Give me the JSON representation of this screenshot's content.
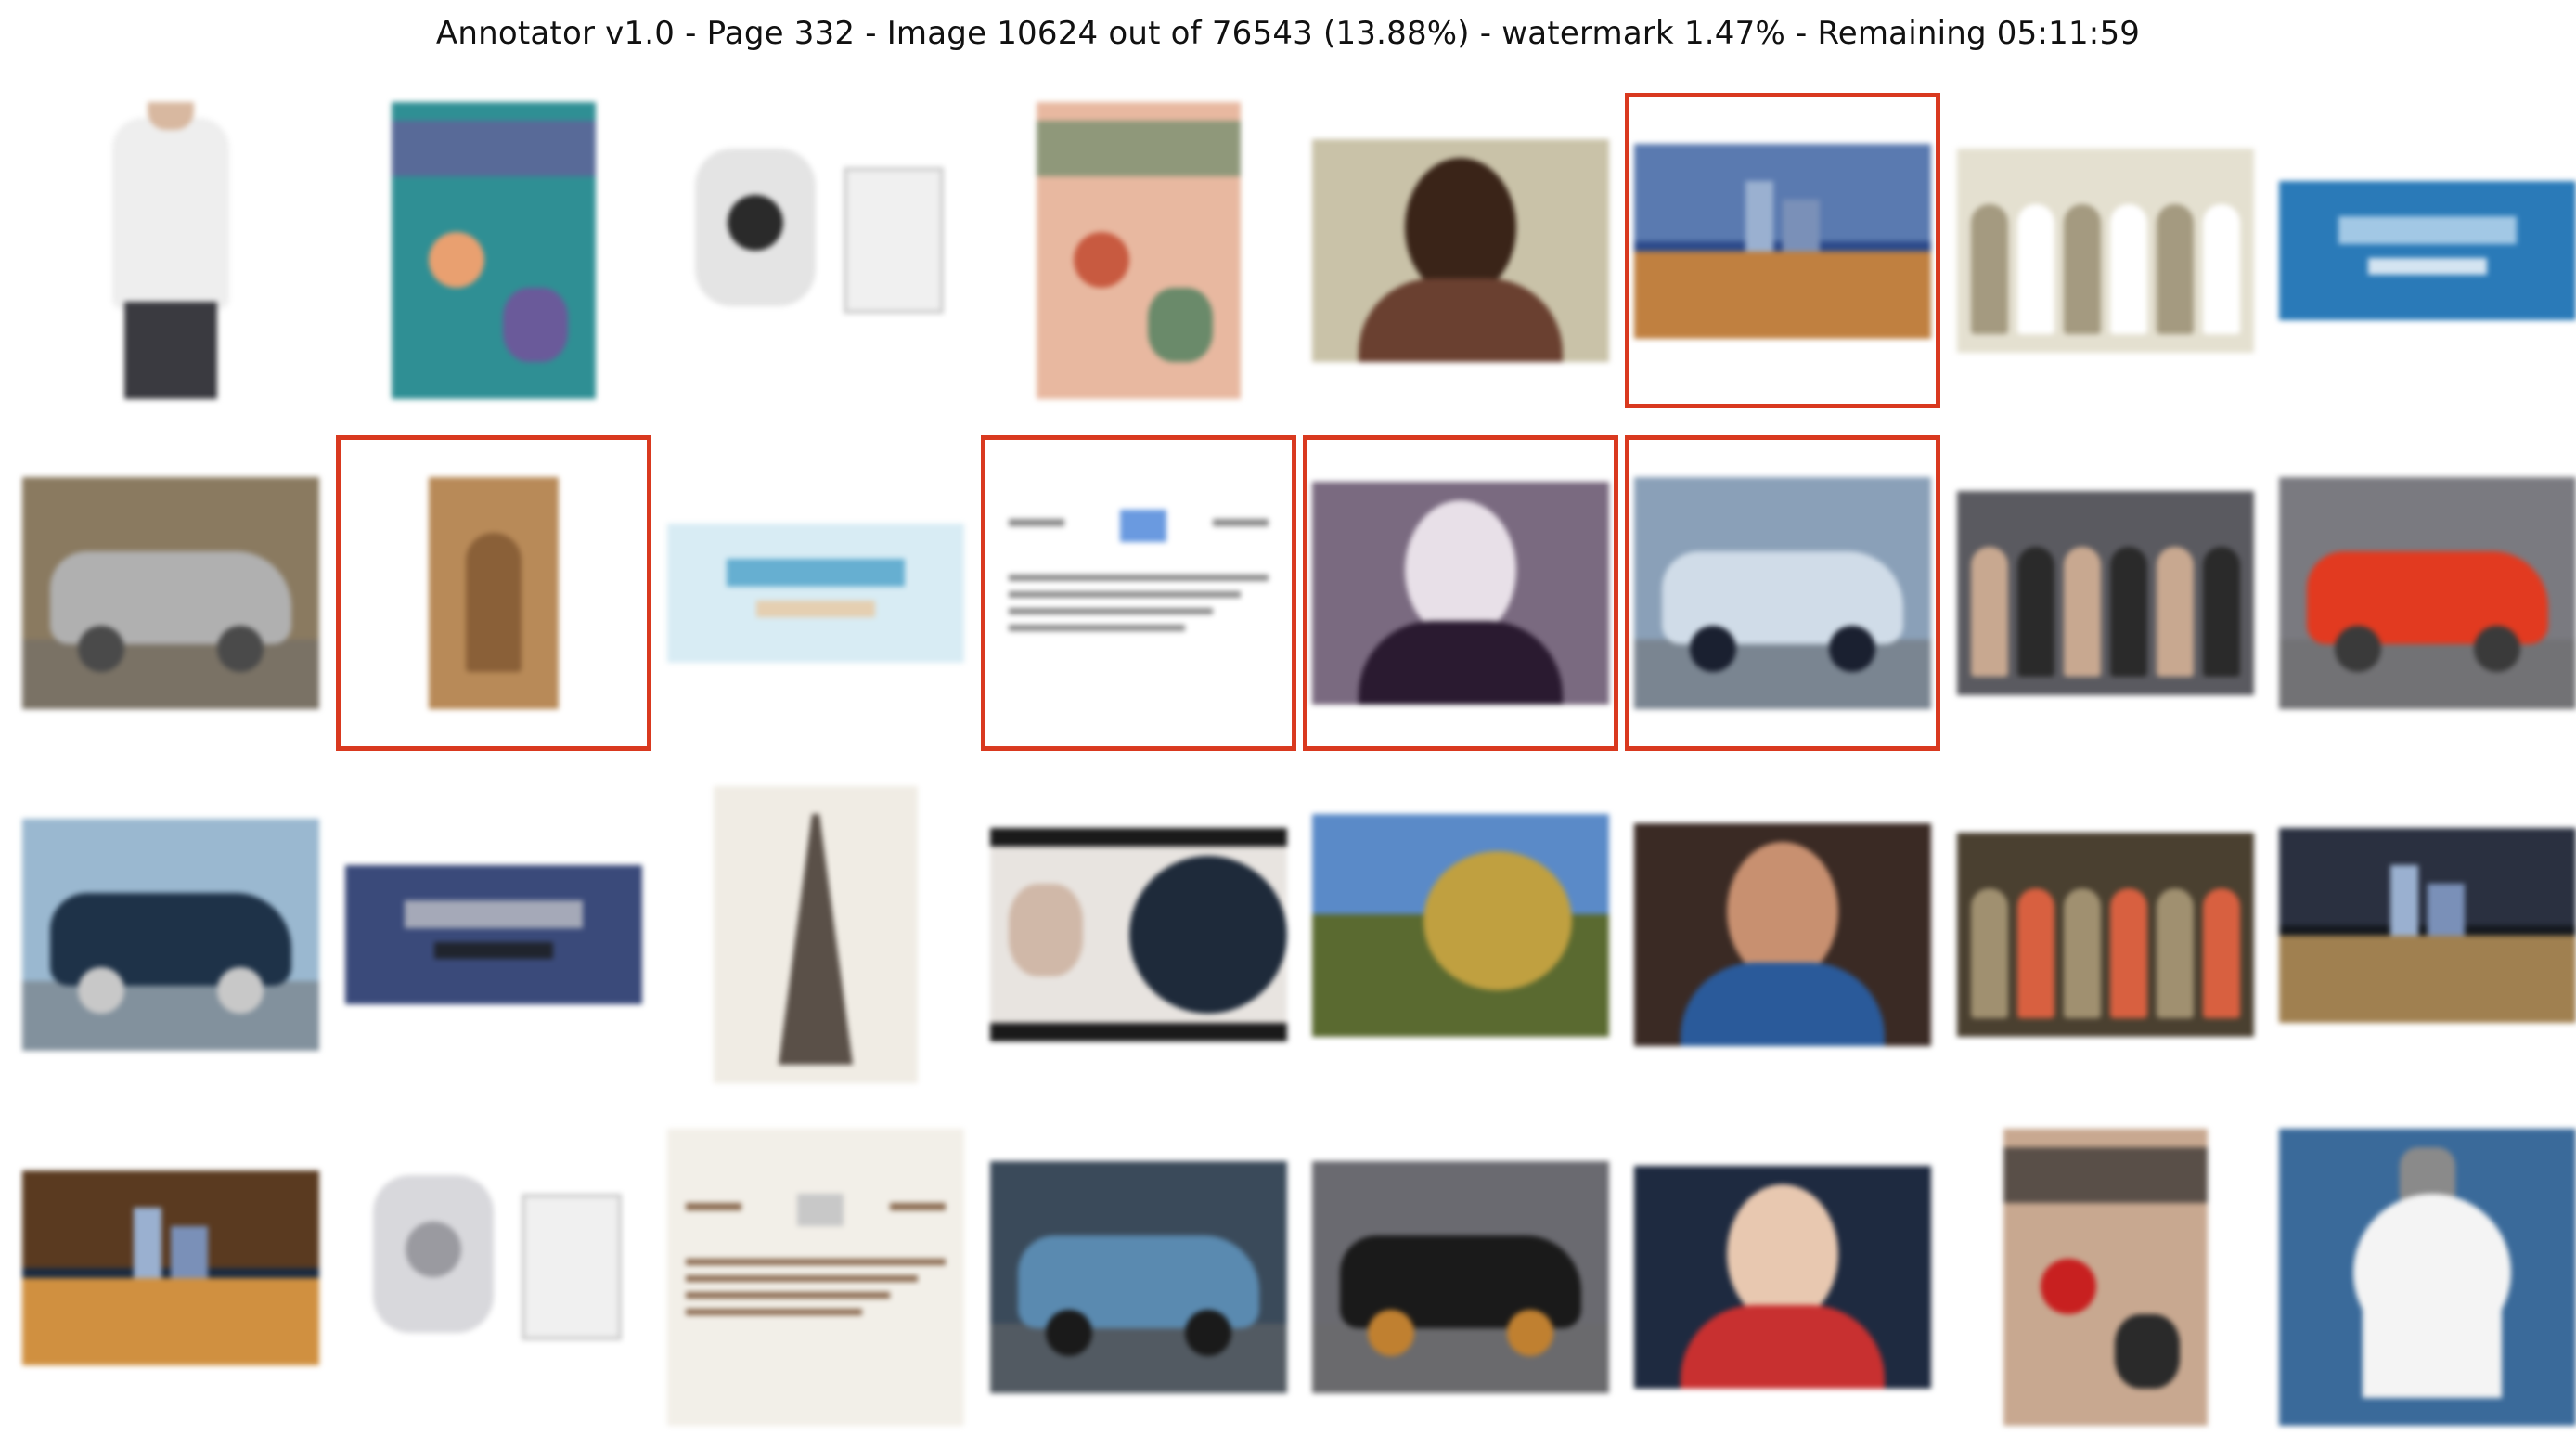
{
  "header": {
    "title": "Annotator v1.0 - Page 332 - Image 10624 out of 76543 (13.88%) - watermark 1.47% - Remaining 05:11:59"
  },
  "colors": {
    "selection_border": "#d9391f",
    "background": "#ffffff"
  },
  "grid": {
    "rows": 4,
    "columns": 8,
    "items": [
      {
        "name": "thumb-white-tshirt",
        "selected": false,
        "bg": "#ffffff",
        "accent": "#eeeeee",
        "accent2": "#3a3a40",
        "style": "tshirt"
      },
      {
        "name": "thumb-teal-poster",
        "selected": false,
        "bg": "#2f8f94",
        "accent": "#e9a070",
        "accent2": "#6a5a9a",
        "style": "poster"
      },
      {
        "name": "thumb-baby-monitor",
        "selected": false,
        "bg": "#ffffff",
        "accent": "#e4e4e4",
        "accent2": "#2a2a2a",
        "style": "device"
      },
      {
        "name": "thumb-vintage-book-cover",
        "selected": false,
        "bg": "#e8b8a0",
        "accent": "#c85a40",
        "accent2": "#6a8a6a",
        "style": "poster"
      },
      {
        "name": "thumb-woman-portrait",
        "selected": false,
        "bg": "#c9c2a8",
        "accent": "#3a2418",
        "accent2": "#6a4030",
        "style": "portrait"
      },
      {
        "name": "thumb-city-skyline",
        "selected": true,
        "bg": "#2c4a8a",
        "accent": "#c08040",
        "accent2": "#5a7ab0",
        "style": "skyline"
      },
      {
        "name": "thumb-choir-group",
        "selected": false,
        "bg": "#e4e0d0",
        "accent": "#ffffff",
        "accent2": "#a49a80",
        "style": "group"
      },
      {
        "name": "thumb-blue-banner",
        "selected": false,
        "bg": "#2a7ab8",
        "accent": "#c0dcf0",
        "accent2": "#ffffff",
        "style": "banner"
      },
      {
        "name": "thumb-silver-suv",
        "selected": false,
        "bg": "#8a7a60",
        "accent": "#b0b0b0",
        "accent2": "#4a4a4a",
        "style": "car"
      },
      {
        "name": "thumb-sepia-photo",
        "selected": true,
        "bg": "#ffffff",
        "accent": "#b88a58",
        "accent2": "#8a6038",
        "style": "sepia"
      },
      {
        "name": "thumb-promo-banner",
        "selected": false,
        "bg": "#d8ecf4",
        "accent": "#4aa0c8",
        "accent2": "#e8c8a0",
        "style": "banner"
      },
      {
        "name": "thumb-text-document",
        "selected": true,
        "bg": "#ffffff",
        "accent": "#6a9ae0",
        "accent2": "#8a8a8a",
        "style": "document"
      },
      {
        "name": "thumb-military-portrait",
        "selected": true,
        "bg": "#7a6a80",
        "accent": "#e8e0e8",
        "accent2": "#2a1a30",
        "style": "portrait"
      },
      {
        "name": "thumb-white-car-front",
        "selected": true,
        "bg": "#8aa0b8",
        "accent": "#d0dce8",
        "accent2": "#1a2030",
        "style": "car"
      },
      {
        "name": "thumb-people-seated",
        "selected": false,
        "bg": "#5a5a60",
        "accent": "#2a2a2a",
        "accent2": "#c8a890",
        "style": "group"
      },
      {
        "name": "thumb-red-sports-car",
        "selected": false,
        "bg": "#7a7a80",
        "accent": "#e23a20",
        "accent2": "#3a3a3a",
        "style": "car"
      },
      {
        "name": "thumb-dark-sedan",
        "selected": false,
        "bg": "#9ab8d0",
        "accent": "#1e3248",
        "accent2": "#c8c8c8",
        "style": "car"
      },
      {
        "name": "thumb-train-banner",
        "selected": false,
        "bg": "#3a4a7a",
        "accent": "#c0c0c8",
        "accent2": "#1a1a1a",
        "style": "banner"
      },
      {
        "name": "thumb-eiffel-tower",
        "selected": false,
        "bg": "#f0ece4",
        "accent": "#5a5048",
        "accent2": "#c8c0b0",
        "style": "tower"
      },
      {
        "name": "thumb-curly-hair-video",
        "selected": false,
        "bg": "#1a1a1a",
        "accent": "#1e2a3a",
        "accent2": "#d0b8a8",
        "style": "video"
      },
      {
        "name": "thumb-bike-jump",
        "selected": false,
        "bg": "#5a8ac8",
        "accent": "#c0a040",
        "accent2": "#5a6a30",
        "style": "landscape"
      },
      {
        "name": "thumb-smiling-man",
        "selected": false,
        "bg": "#3a2a24",
        "accent": "#c89070",
        "accent2": "#2a5a9a",
        "style": "portrait"
      },
      {
        "name": "thumb-collage-photo",
        "selected": false,
        "bg": "#4a4030",
        "accent": "#d86040",
        "accent2": "#a09070",
        "style": "group"
      },
      {
        "name": "thumb-night-bridge",
        "selected": false,
        "bg": "#14181e",
        "accent": "#a08050",
        "accent2": "#2a3040",
        "style": "skyline"
      },
      {
        "name": "thumb-storefront",
        "selected": false,
        "bg": "#1a2a40",
        "accent": "#d09040",
        "accent2": "#5a3a20",
        "style": "skyline"
      },
      {
        "name": "thumb-kitchen-appliance",
        "selected": false,
        "bg": "#ffffff",
        "accent": "#d8d8dc",
        "accent2": "#9a9aa0",
        "style": "device"
      },
      {
        "name": "thumb-webpage-screenshot",
        "selected": false,
        "bg": "#f2efe8",
        "accent": "#c8c8c8",
        "accent2": "#8a6a50",
        "style": "document"
      },
      {
        "name": "thumb-race-car",
        "selected": false,
        "bg": "#3a4a5a",
        "accent": "#5a8ab0",
        "accent2": "#1a1a1a",
        "style": "car"
      },
      {
        "name": "thumb-formula-car",
        "selected": false,
        "bg": "#6a6a70",
        "accent": "#1a1a1a",
        "accent2": "#c08030",
        "style": "car"
      },
      {
        "name": "thumb-politician-flag",
        "selected": false,
        "bg": "#1e2a40",
        "accent": "#e8c8b0",
        "accent2": "#c83030",
        "style": "portrait"
      },
      {
        "name": "thumb-movie-poster",
        "selected": false,
        "bg": "#c8a890",
        "accent": "#c82020",
        "accent2": "#2a2a2a",
        "style": "poster"
      },
      {
        "name": "thumb-toilet-paper",
        "selected": false,
        "bg": "#3a6a9a",
        "accent": "#f4f4f4",
        "accent2": "#8a8a8a",
        "style": "roll"
      }
    ]
  }
}
